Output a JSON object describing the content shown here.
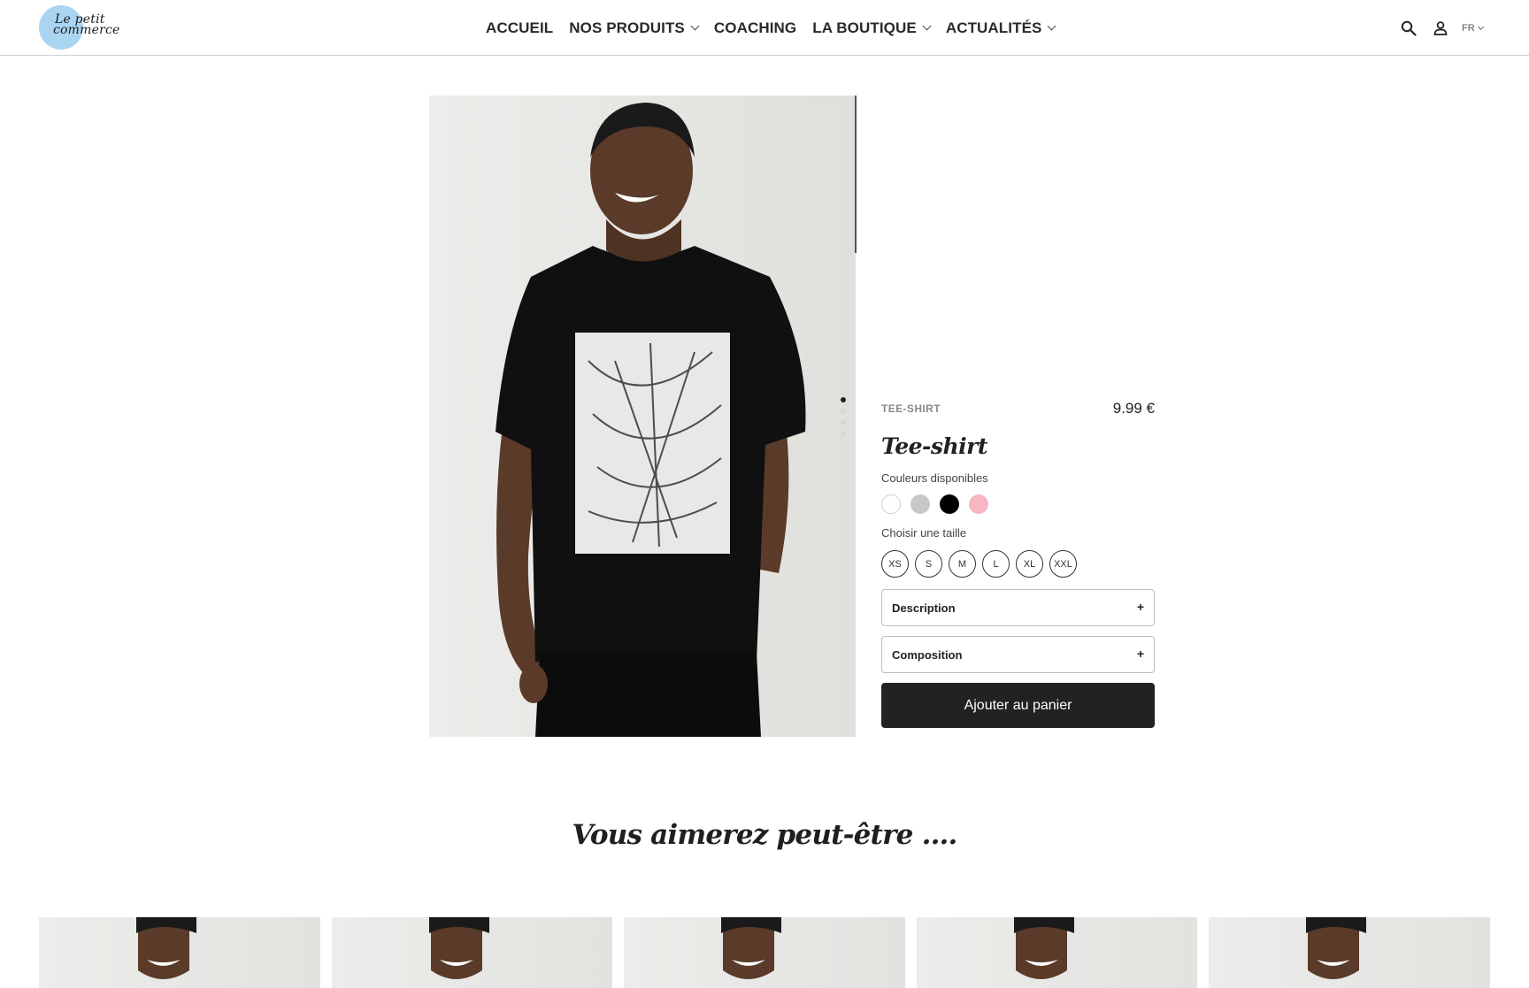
{
  "brand": {
    "logo_line1": "Le petit",
    "logo_line2": "commerce"
  },
  "nav": [
    {
      "label": "ACCUEIL",
      "has_dropdown": false
    },
    {
      "label": "NOS PRODUITS",
      "has_dropdown": true
    },
    {
      "label": "COACHING",
      "has_dropdown": false
    },
    {
      "label": "LA BOUTIQUE",
      "has_dropdown": true
    },
    {
      "label": "ACTUALITÉS",
      "has_dropdown": true
    }
  ],
  "header_icons": [
    "search-icon",
    "user-icon"
  ],
  "language": "FR",
  "product": {
    "category": "TEE-SHIRT",
    "price": "9.99 €",
    "title": "Tee-shirt",
    "colors_label": "Couleurs disponibles",
    "colors": [
      {
        "name": "white",
        "hex": "#ffffff"
      },
      {
        "name": "grey",
        "hex": "#c8c8c8"
      },
      {
        "name": "black",
        "hex": "#000000"
      },
      {
        "name": "pink",
        "hex": "#f7b6c4"
      }
    ],
    "size_label": "Choisir une taille",
    "sizes": [
      "XS",
      "S",
      "M",
      "L",
      "XL",
      "XXL"
    ],
    "accordions": [
      {
        "label": "Description",
        "toggle": "+"
      },
      {
        "label": "Composition",
        "toggle": "+"
      }
    ],
    "add_to_cart": "Ajouter au panier",
    "image_count": 4,
    "active_image": 0
  },
  "related": {
    "title": "Vous aimerez peut-être ....",
    "count": 5
  },
  "colors": {
    "primary_button": "#222222",
    "logo_circle": "#a9d4f2"
  }
}
